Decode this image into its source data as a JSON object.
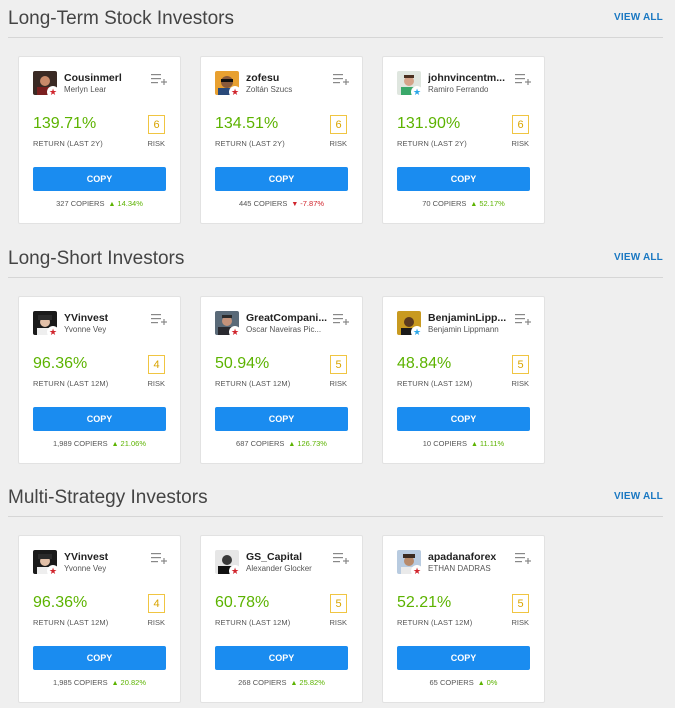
{
  "colors": {
    "accent": "#1a78c2",
    "button": "#1a8cf0",
    "gain": "#5cb300",
    "risk": "#f0c542",
    "negative": "#d0242c"
  },
  "sections": [
    {
      "title": "Long-Term Stock Investors",
      "view_all": "VIEW ALL",
      "cards": [
        {
          "username": "Cousinmerl",
          "fullname": "Merlyn Lear",
          "badge": "red-star-icon",
          "gain": "139.71%",
          "gain_label": "RETURN (LAST 2Y)",
          "risk": "6",
          "risk_label": "RISK",
          "copy_label": "COPY",
          "copiers": "327 COPIERS",
          "trend": "up",
          "change": "14.34%"
        },
        {
          "username": "zofesu",
          "fullname": "Zoltán Szucs",
          "badge": "red-star-icon",
          "gain": "134.51%",
          "gain_label": "RETURN (LAST 2Y)",
          "risk": "6",
          "risk_label": "RISK",
          "copy_label": "COPY",
          "copiers": "445 COPIERS",
          "trend": "down",
          "change": "-7.87%"
        },
        {
          "username": "johnvincentm...",
          "fullname": "Ramiro Ferrando",
          "badge": "blue-star-icon",
          "gain": "131.90%",
          "gain_label": "RETURN (LAST 2Y)",
          "risk": "6",
          "risk_label": "RISK",
          "copy_label": "COPY",
          "copiers": "70 COPIERS",
          "trend": "up",
          "change": "52.17%"
        }
      ]
    },
    {
      "title": "Long-Short Investors",
      "view_all": "VIEW ALL",
      "cards": [
        {
          "username": "YVinvest",
          "fullname": "Yvonne Vey",
          "badge": "red-star-icon",
          "gain": "96.36%",
          "gain_label": "RETURN (LAST 12M)",
          "risk": "4",
          "risk_label": "RISK",
          "copy_label": "COPY",
          "copiers": "1,989 COPIERS",
          "trend": "up",
          "change": "21.06%"
        },
        {
          "username": "GreatCompani...",
          "fullname": "Oscar Naveiras Pic...",
          "badge": "red-star-icon",
          "gain": "50.94%",
          "gain_label": "RETURN (LAST 12M)",
          "risk": "5",
          "risk_label": "RISK",
          "copy_label": "COPY",
          "copiers": "687 COPIERS",
          "trend": "up",
          "change": "126.73%"
        },
        {
          "username": "BenjaminLipp...",
          "fullname": "Benjamin Lippmann",
          "badge": "blue-star-icon",
          "gain": "48.84%",
          "gain_label": "RETURN (LAST 12M)",
          "risk": "5",
          "risk_label": "RISK",
          "copy_label": "COPY",
          "copiers": "10 COPIERS",
          "trend": "up",
          "change": "11.11%"
        }
      ]
    },
    {
      "title": "Multi-Strategy Investors",
      "view_all": "VIEW ALL",
      "cards": [
        {
          "username": "YVinvest",
          "fullname": "Yvonne Vey",
          "badge": "red-star-icon",
          "gain": "96.36%",
          "gain_label": "RETURN (LAST 12M)",
          "risk": "4",
          "risk_label": "RISK",
          "copy_label": "COPY",
          "copiers": "1,985 COPIERS",
          "trend": "up",
          "change": "20.82%"
        },
        {
          "username": "GS_Capital",
          "fullname": "Alexander Glocker",
          "badge": "red-star-icon",
          "gain": "60.78%",
          "gain_label": "RETURN (LAST 12M)",
          "risk": "5",
          "risk_label": "RISK",
          "copy_label": "COPY",
          "copiers": "268 COPIERS",
          "trend": "up",
          "change": "25.82%"
        },
        {
          "username": "apadanaforex",
          "fullname": "ETHAN DADRAS",
          "badge": "red-star-icon",
          "gain": "52.21%",
          "gain_label": "RETURN (LAST 12M)",
          "risk": "5",
          "risk_label": "RISK",
          "copy_label": "COPY",
          "copiers": "65 COPIERS",
          "trend": "up",
          "change": "0%"
        }
      ]
    }
  ]
}
